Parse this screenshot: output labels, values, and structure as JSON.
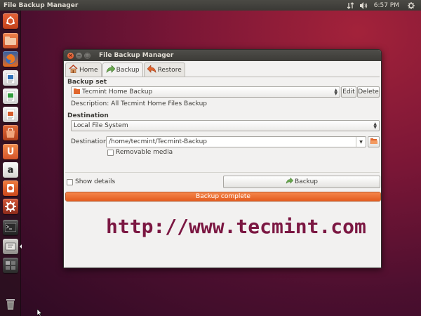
{
  "top_panel": {
    "app_title": "File Backup Manager",
    "clock": "6:57 PM"
  },
  "launcher": {
    "items": [
      {
        "icon": "dash-icon",
        "color": "#dd4814"
      },
      {
        "icon": "files-icon",
        "color": "#e0662c"
      },
      {
        "icon": "firefox-icon",
        "color": "#e86a1c"
      },
      {
        "icon": "writer-icon",
        "color": "#2d6fb6"
      },
      {
        "icon": "calc-icon",
        "color": "#2f9a3b"
      },
      {
        "icon": "impress-icon",
        "color": "#d4592a"
      },
      {
        "icon": "software-center-icon",
        "color": "#c9502a"
      },
      {
        "icon": "ubuntu-one-icon",
        "color": "#e46b2a"
      },
      {
        "icon": "amazon-icon",
        "color": "#e7e5e2"
      },
      {
        "icon": "ubuntu-one-music-icon",
        "color": "#e1591f"
      },
      {
        "icon": "system-settings-icon",
        "color": "#b3442a"
      },
      {
        "icon": "terminal-icon",
        "color": "#2e2e2e"
      },
      {
        "icon": "file-backup-manager-icon",
        "color": "#9b9a96"
      },
      {
        "icon": "workspace-switcher-icon",
        "color": "#3a3a3a"
      },
      {
        "icon": "trash-icon",
        "color": "#6b6b6b"
      }
    ]
  },
  "window": {
    "title": "File Backup Manager",
    "tabs": [
      {
        "label": "Home",
        "icon": "home-icon"
      },
      {
        "label": "Backup",
        "icon": "backup-arrow-icon"
      },
      {
        "label": "Restore",
        "icon": "restore-arrow-icon"
      }
    ],
    "backup_set": {
      "section_label": "Backup set",
      "selected": "Tecmint Home Backup",
      "edit_label": "Edit",
      "delete_label": "Delete",
      "description": "Description: All Tecmint Home Files Backup"
    },
    "destination": {
      "section_label": "Destination",
      "type_selected": "Local File System",
      "path_label": "Destination:",
      "path_value": "/home/tecmint/Tecmint-Backup",
      "removable_label": "Removable media",
      "removable_checked": false
    },
    "show_details_label": "Show details",
    "show_details_checked": false,
    "backup_button_label": "Backup",
    "progress": {
      "text": "Backup complete",
      "fraction": 1.0
    }
  },
  "watermark": "http://www.tecmint.com",
  "colors": {
    "accent": "#e35c1f",
    "watermark": "#7b1742"
  }
}
